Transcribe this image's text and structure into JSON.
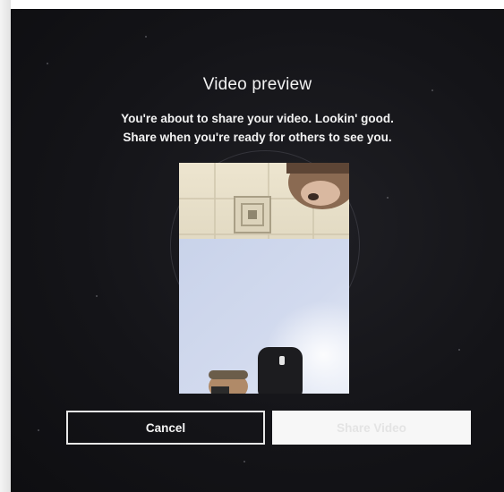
{
  "dialog": {
    "title": "Video preview",
    "message_line1": "You're about to share your video. Lookin' good.",
    "message_line2": "Share when you're ready for others to see you."
  },
  "preview": {
    "content": "camera-self-view"
  },
  "buttons": {
    "cancel_label": "Cancel",
    "share_label": "Share Video"
  },
  "colors": {
    "background": "#141418",
    "text": "#f2f2f2",
    "share_button_bg": "#f7f7f7",
    "cancel_border": "#e8e8e8"
  }
}
